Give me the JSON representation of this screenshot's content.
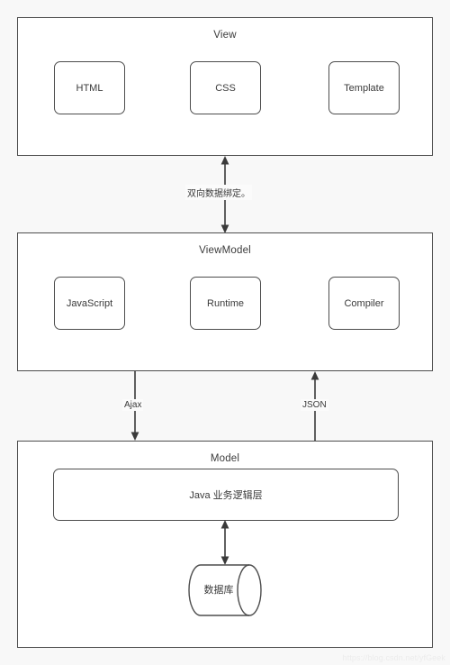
{
  "diagram": {
    "background_color": "#f8f8f8",
    "stroke_color": "#4d4d4d",
    "text_color": "#3a3a3a",
    "layers": [
      {
        "id": "view",
        "title": "View",
        "components": [
          {
            "label": "HTML"
          },
          {
            "label": "CSS"
          },
          {
            "label": "Template"
          }
        ]
      },
      {
        "id": "viewmodel",
        "title": "ViewModel",
        "components": [
          {
            "label": "JavaScript"
          },
          {
            "label": "Runtime"
          },
          {
            "label": "Compiler"
          }
        ]
      },
      {
        "id": "model",
        "title": "Model",
        "business_box": "Java 业务逻辑层",
        "datastore": "数据库"
      }
    ],
    "connectors": [
      {
        "id": "view-viewmodel",
        "label": "双向数据绑定。",
        "direction": "both"
      },
      {
        "id": "ajax",
        "label": "Ajax",
        "direction": "down"
      },
      {
        "id": "json",
        "label": "JSON",
        "direction": "up"
      },
      {
        "id": "java-db",
        "label": "",
        "direction": "both"
      }
    ],
    "watermark": "https://blog.csdn.net/yfGeek"
  }
}
